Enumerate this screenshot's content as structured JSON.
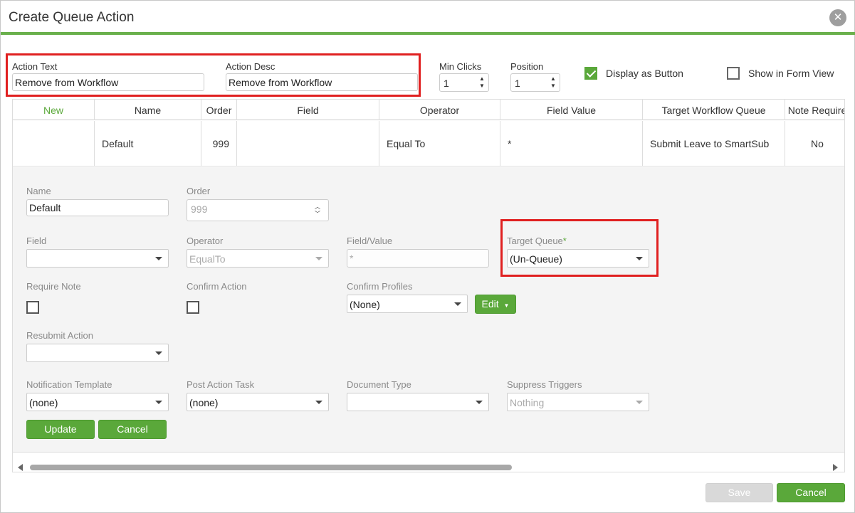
{
  "dialog": {
    "title": "Create Queue Action"
  },
  "top_form": {
    "action_text_label": "Action Text",
    "action_text_value": "Remove from Workflow",
    "action_desc_label": "Action Desc",
    "action_desc_value": "Remove from Workflow",
    "min_clicks_label": "Min Clicks",
    "min_clicks_value": "1",
    "position_label": "Position",
    "position_value": "1",
    "display_as_button_label": "Display as Button",
    "display_as_button_checked": true,
    "show_in_form_view_label": "Show in Form View",
    "show_in_form_view_checked": false
  },
  "grid": {
    "columns": [
      "New",
      "Name",
      "Order",
      "Field",
      "Operator",
      "Field Value",
      "Target Workflow Queue",
      "Note Require"
    ],
    "rows": [
      {
        "name": "Default",
        "order": "999",
        "field": "",
        "operator": "Equal To",
        "field_value": "*",
        "target_queue": "Submit Leave to SmartSub",
        "note_required": "No"
      }
    ]
  },
  "edit_form": {
    "name_label": "Name",
    "name_value": "Default",
    "order_label": "Order",
    "order_value": "999",
    "field_label": "Field",
    "field_value": "",
    "operator_label": "Operator",
    "operator_value": "EqualTo",
    "field_value_label": "Field/Value",
    "field_value_placeholder": "*",
    "target_queue_label": "Target Queue",
    "target_queue_required": "*",
    "target_queue_value": "(Un-Queue)",
    "require_note_label": "Require Note",
    "confirm_action_label": "Confirm Action",
    "confirm_profiles_label": "Confirm Profiles",
    "confirm_profiles_value": "(None)",
    "edit_button_label": "Edit",
    "resubmit_action_label": "Resubmit Action",
    "resubmit_action_value": "",
    "notification_template_label": "Notification Template",
    "notification_template_value": "(none)",
    "post_action_task_label": "Post Action Task",
    "post_action_task_value": "(none)",
    "document_type_label": "Document Type",
    "document_type_value": "",
    "suppress_triggers_label": "Suppress Triggers",
    "suppress_triggers_value": "Nothing",
    "update_button_label": "Update",
    "cancel_button_label": "Cancel"
  },
  "footer": {
    "save_label": "Save",
    "cancel_label": "Cancel"
  },
  "colors": {
    "accent_green": "#5aa83a",
    "highlight_red": "#e02020"
  }
}
